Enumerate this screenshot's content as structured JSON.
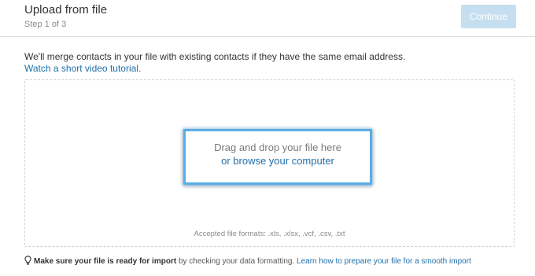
{
  "header": {
    "title": "Upload from file",
    "step": "Step 1 of 3",
    "continue_label": "Continue"
  },
  "intro": {
    "merge_note": "We'll merge contacts in your file with existing contacts if they have the same email address.",
    "video_link": "Watch a short video tutorial."
  },
  "dropzone": {
    "drag_text": "Drag and drop your file here",
    "browse_link": "or browse your computer",
    "accepted_formats": "Accepted file formats: .xls, .xlsx, .vcf, .csv, .txt"
  },
  "tip": {
    "icon": "lightbulb-icon",
    "strong_text": "Make sure your file is ready for import",
    "body_text": " by checking your data formatting. ",
    "link_text": "Learn how to prepare your file for a smooth import"
  },
  "colors": {
    "link": "#1f6fa9",
    "continue_disabled": "#c6dff0",
    "highlight": "#5aaee6"
  }
}
